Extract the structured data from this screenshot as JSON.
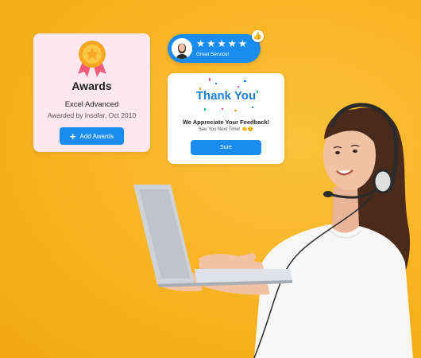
{
  "awards_card": {
    "title": "Awards",
    "award_name": "Excel Advanced",
    "award_meta": "Awarded by insofar, Oct 2010",
    "add_button_label": "Add Awards"
  },
  "rating": {
    "stars": 5,
    "text": "Great Service!"
  },
  "thanks_card": {
    "title": "Thank You",
    "message": "We Appreciate Your Feedback!",
    "sub": "See You Next Time! 👏😊",
    "button_label": "Sure"
  },
  "colors": {
    "background": "#f7b321",
    "accent_blue": "#1a8cf0",
    "awards_card_bg": "#fde8ef",
    "thanks_title": "#1a7fd9"
  },
  "icons": {
    "medal": "medal-icon",
    "add": "plus-icon",
    "star": "star-icon",
    "thumbs_up": "thumbs-up-icon"
  }
}
